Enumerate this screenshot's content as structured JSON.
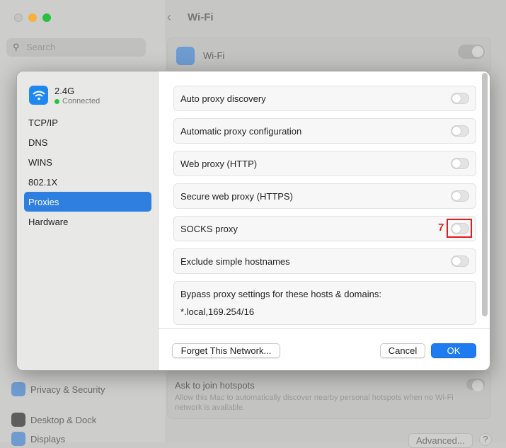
{
  "background": {
    "search_placeholder": "Search",
    "title": "Wi-Fi",
    "wifi_row_label": "Wi-Fi",
    "sidebar_items": [
      "Privacy & Security",
      "Desktop & Dock",
      "Displays"
    ],
    "hotspot_title": "Ask to join hotspots",
    "hotspot_desc": "Allow this Mac to automatically discover nearby personal hotspots when no Wi-Fi network is available.",
    "advanced_label": "Advanced...",
    "help_label": "?"
  },
  "dialog": {
    "network": {
      "name": "2.4G",
      "status": "Connected",
      "status_color": "#29c240"
    },
    "nav": [
      "TCP/IP",
      "DNS",
      "WINS",
      "802.1X",
      "Proxies",
      "Hardware"
    ],
    "selected_nav": "Proxies",
    "proxies": [
      {
        "label": "Auto proxy discovery",
        "enabled": false
      },
      {
        "label": "Automatic proxy configuration",
        "enabled": false
      },
      {
        "label": "Web proxy (HTTP)",
        "enabled": false
      },
      {
        "label": "Secure web proxy (HTTPS)",
        "enabled": false
      },
      {
        "label": "SOCKS proxy",
        "enabled": false
      },
      {
        "label": "Exclude simple hostnames",
        "enabled": false
      }
    ],
    "bypass_label": "Bypass proxy settings for these hosts & domains:",
    "bypass_value": "*.local,169.254/16",
    "forget_label": "Forget This Network...",
    "cancel_label": "Cancel",
    "ok_label": "OK",
    "accent": "#1e7cf0"
  },
  "annotation": {
    "number": "7",
    "color": "#e21b1b"
  }
}
